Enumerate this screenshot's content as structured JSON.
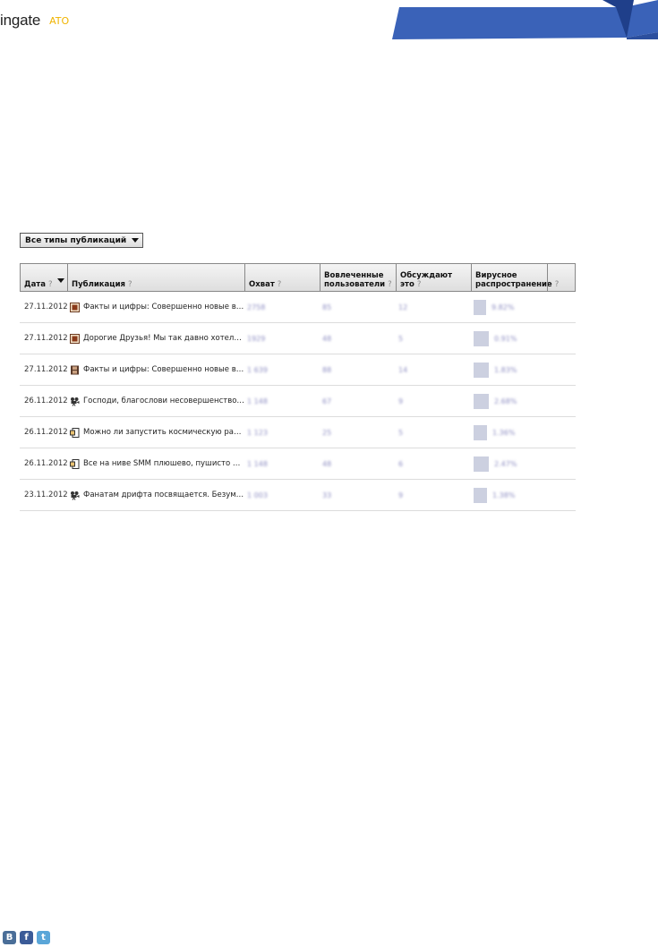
{
  "header": {
    "brand_name": "ingate",
    "logo_text": "ATO"
  },
  "filter": {
    "label": "Все типы публикаций"
  },
  "table": {
    "columns": {
      "date": "Дата",
      "publication": "Публикация",
      "reach": "Охват",
      "engaged_1": "Вовлеченные",
      "engaged_2": "пользователи",
      "talking_1": "Обсуждают",
      "talking_2": "это",
      "viral_1": "Вирусное",
      "viral_2": "распространение",
      "help": "?"
    },
    "rows": [
      {
        "date": "27.11.2012",
        "type_icon": "photo-icon",
        "text": "Факты и цифры: Совершенно новые во...",
        "reach": "2758",
        "engaged": "85",
        "talking": "12",
        "viral": "9.82%",
        "viral_level": 0.6
      },
      {
        "date": "27.11.2012",
        "type_icon": "photo-icon",
        "text": "Дорогие Друзья! Мы так давно хотели...",
        "reach": "1929",
        "engaged": "48",
        "talking": "5",
        "viral": "0.91%",
        "viral_level": 1.0
      },
      {
        "date": "27.11.2012",
        "type_icon": "film-icon",
        "text": "Факты и цифры: Совершенно новые во...",
        "reach": "1 639",
        "engaged": "88",
        "talking": "14",
        "viral": "1.83%",
        "viral_level": 1.0
      },
      {
        "date": "26.11.2012",
        "type_icon": "video-icon",
        "text": "Господи, благослови несовершенство F...",
        "reach": "1 148",
        "engaged": "67",
        "talking": "9",
        "viral": "2.68%",
        "viral_level": 1.0
      },
      {
        "date": "26.11.2012",
        "type_icon": "link-icon",
        "text": "Можно ли запустить космическую раке...",
        "reach": "1 123",
        "engaged": "25",
        "talking": "5",
        "viral": "1.36%",
        "viral_level": 0.7
      },
      {
        "date": "26.11.2012",
        "type_icon": "link-icon",
        "text": "Все на ниве SMM плюшево, пушисто и...",
        "reach": "1 148",
        "engaged": "48",
        "talking": "6",
        "viral": "2.47%",
        "viral_level": 1.0
      },
      {
        "date": "23.11.2012",
        "type_icon": "video-icon",
        "text": "Фанатам дрифта посвящается. Безумн...",
        "reach": "1 003",
        "engaged": "33",
        "talking": "9",
        "viral": "1.38%",
        "viral_level": 0.7
      }
    ]
  },
  "social": {
    "vk": "В",
    "fb": "f",
    "tw": "t"
  },
  "colors": {
    "banner": "#3a62b8",
    "banner_dark": "#1f3f8a",
    "accent_link": "#6a3b5a"
  }
}
